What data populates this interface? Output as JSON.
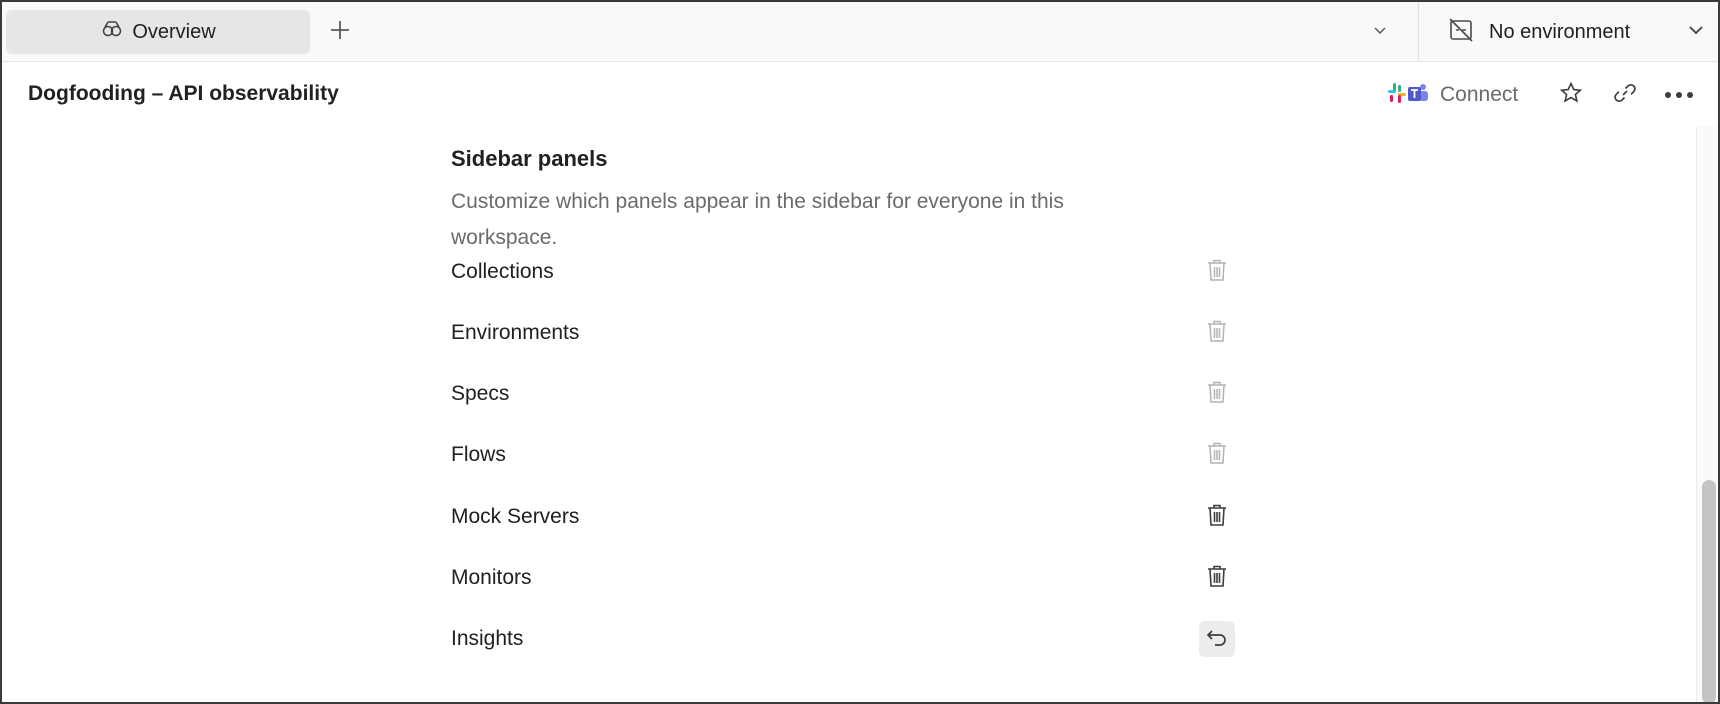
{
  "tabbar": {
    "active_tab": {
      "label": "Overview",
      "icon": "workspace-overview-icon"
    },
    "new_tab_icon": "plus-icon",
    "tabs_menu_icon": "chevron-down-icon"
  },
  "environment": {
    "label": "No environment",
    "icon": "no-environment-icon"
  },
  "header": {
    "title": "Dogfooding – API observability",
    "connect_label": "Connect",
    "icons": [
      "slack-icon",
      "teams-icon",
      "star-icon",
      "link-icon",
      "more-icon"
    ]
  },
  "sidebar_panels": {
    "title": "Sidebar panels",
    "description": "Customize which panels appear in the sidebar for everyone in this workspace.",
    "items": [
      {
        "label": "Collections",
        "action": "delete",
        "state": "disabled"
      },
      {
        "label": "Environments",
        "action": "delete",
        "state": "disabled"
      },
      {
        "label": "Specs",
        "action": "delete",
        "state": "disabled"
      },
      {
        "label": "Flows",
        "action": "delete",
        "state": "disabled"
      },
      {
        "label": "Mock Servers",
        "action": "delete",
        "state": "enabled"
      },
      {
        "label": "Monitors",
        "action": "delete",
        "state": "enabled"
      },
      {
        "label": "Insights",
        "action": "restore",
        "state": "enabled"
      }
    ]
  },
  "colors": {
    "text_primary": "#212121",
    "text_secondary": "#6b6b6b",
    "icon_disabled": "#b3b3b3",
    "icon_enabled": "#3d3d3d",
    "tab_active_bg": "#e6e6e6"
  }
}
